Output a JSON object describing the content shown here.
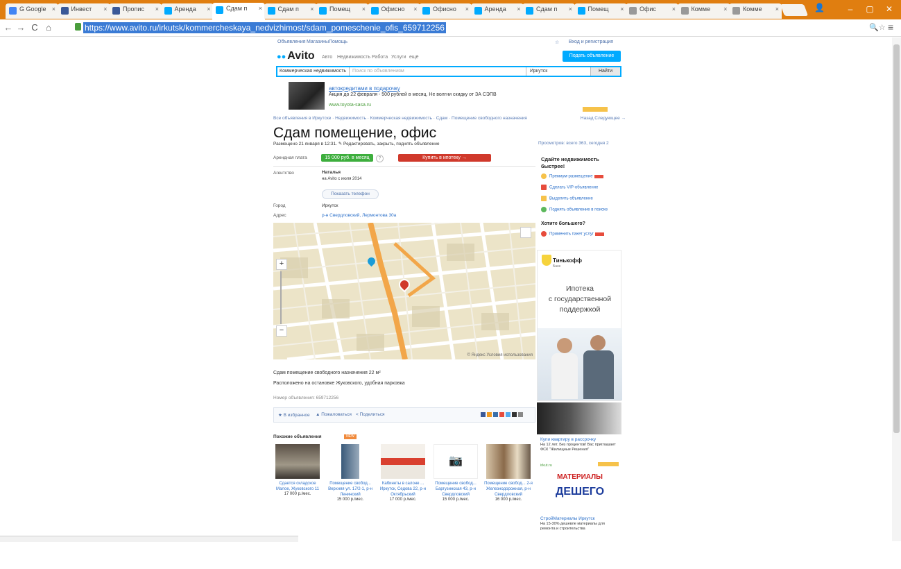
{
  "browser": {
    "tabs": [
      {
        "label": "G Google",
        "color": "#4285f4"
      },
      {
        "label": "Инвест",
        "color": "#3b5998"
      },
      {
        "label": "Пропис",
        "color": "#3b5998"
      },
      {
        "label": "Аренда",
        "color": "#00aaff"
      },
      {
        "label": "Сдам п",
        "color": "#00aaff"
      },
      {
        "label": "Сдам п",
        "color": "#00aaff"
      },
      {
        "label": "Помещ",
        "color": "#00aaff"
      },
      {
        "label": "Офисно",
        "color": "#00aaff"
      },
      {
        "label": "Офисно",
        "color": "#00aaff"
      },
      {
        "label": "Аренда",
        "color": "#00aaff"
      },
      {
        "label": "Сдам п",
        "color": "#00aaff"
      },
      {
        "label": "Помещ",
        "color": "#00aaff"
      },
      {
        "label": "Офис",
        "color": "#999999"
      },
      {
        "label": "Комме",
        "color": "#999999"
      },
      {
        "label": "Комме",
        "color": "#999999"
      }
    ],
    "active_tab": 4,
    "url": "https://www.avito.ru/irkutsk/kommercheskaya_nedvizhimost/sdam_pomeschenie_ofis_659712256",
    "window_controls": {
      "minimize": "–",
      "maximize": "▢",
      "close": "✕"
    }
  },
  "site": {
    "top_menu": [
      "Объявления",
      "Магазины",
      "Помощь"
    ],
    "top_right": [
      "☆",
      "Вход и регистрация"
    ],
    "logo": "Avito",
    "nav": [
      "Авто",
      "Недвижимость",
      "Работа",
      "Услуги",
      "ещё"
    ],
    "post_button": "Подать объявление",
    "search": {
      "category": "Коммерческая недвижимость",
      "placeholder": "Поиск по объявлениям",
      "city": "Иркутск",
      "button": "Найти"
    }
  },
  "ad_banner": {
    "title": "автокредитами в подарочку",
    "text": "Акция до 22 февраля - 500 рублей в месяц. Не волгни скидку от ЗА СЭПВ",
    "url": "www.toyota-sasa.ru"
  },
  "breadcrumb": {
    "items": [
      "Все объявления в Иркутске",
      "Недвижимость",
      "Коммерческая недвижимость",
      "Сдам",
      "Помещение свободного назначения"
    ],
    "right": "Назад  Следующее →"
  },
  "listing": {
    "title": "Сдам помещение, офис",
    "posted": "Размещено 21 января в 12:31.   ✎ Редактировать, закрыть, поднять объявление",
    "views": "Просмотров: всего 363, сегодня 2",
    "price_label": "Арендная плата",
    "price": "15 000 руб. в месяц",
    "mortgage_button": "Купить в ипотеку →",
    "seller_label": "Агентство",
    "seller_name": "Наталья",
    "seller_since": "на Avito с июля 2014",
    "phone_button": "Показать телефон",
    "city_label": "Город",
    "city_value": "Иркутск",
    "address_label": "Адрес",
    "address_value": "р-н Свердловский, Лермонтова 30а",
    "description_line1": "Сдам помещение свободного назначения 22 м²",
    "description_line2": "Расположено на остановке Жуковского, удобная парковка",
    "ad_number": "Номер объявления: 659712256",
    "share": [
      "★ В избранное",
      "▲ Пожаловаться",
      "< Поделиться"
    ],
    "map_copyright": "© Яндекс  Условия использования"
  },
  "similar": {
    "title": "Похожие объявления",
    "badge": "NEW",
    "items": [
      {
        "text": "Сдается складское Малое, Жуковского 11",
        "price": "17 000 р./мес."
      },
      {
        "text": "Помещение свобод... Верхняя ул. 17/2-1, р-н Ленинский",
        "price": "15 000 р./мес."
      },
      {
        "text": "Кабинеты в салоне ... Иркутск, Седова 22, р-н Октябрьский",
        "price": "17 000 р./мес."
      },
      {
        "text": "Помещение свобод... Баргузинская 43, р-н Свердловский",
        "price": "15 000 р./мес."
      },
      {
        "text": "Помещение свобод... 2-я Железнодорожная, р-н Свердловский",
        "price": "16 000 р./мес."
      }
    ]
  },
  "sell_box": {
    "heading": "Сдайте недвижимость быстрее!",
    "services": [
      "Премиум-размещение",
      "Сделать VIP-объявление",
      "Выделить объявление",
      "Поднять объявление в поиске"
    ],
    "more_heading": "Хотите большего?",
    "more_service": "Применить пакет услуг"
  },
  "tinkoff": {
    "logo": "Тинькофф",
    "sub": "Банк",
    "text_1": "Ипотека",
    "text_2": "с государственной",
    "text_3": "поддержкой"
  },
  "realty_ad": {
    "title": "Купи квартиру в рассрочку",
    "text": "На 12 лет. Без процентов! Вас приглашает ФСК \"Жилищные Решения\"",
    "link": "irkut.ru"
  },
  "materials_ad": {
    "top": "МАТЕРИАЛЫ",
    "bottom": "ДЕШЕГО",
    "title": "СтройМатериалы Иркутск",
    "text": "На 15-30% дешевле материалы для ремонта и строительства"
  }
}
